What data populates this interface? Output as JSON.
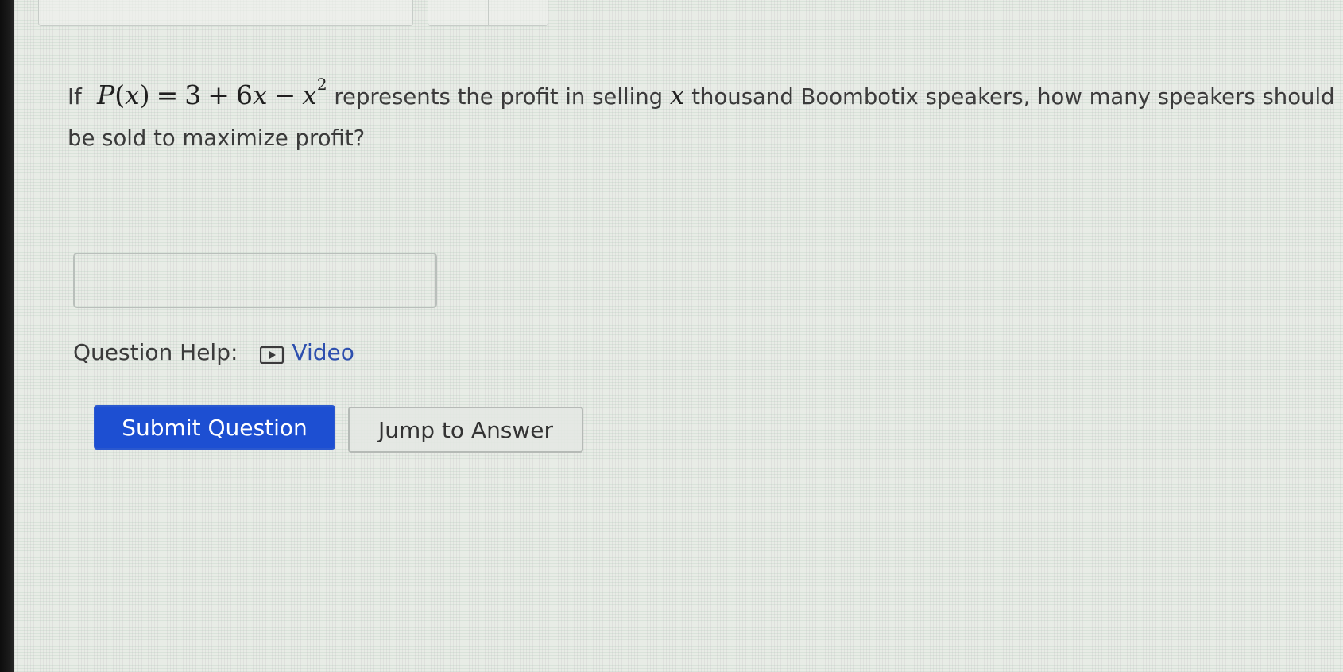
{
  "question": {
    "prefix": "If",
    "formula": {
      "func": "P",
      "var": "x",
      "rhs_const": "3",
      "rhs_term_coef": "6",
      "rhs_term_var": "x",
      "minus_var": "x",
      "exponent": "2"
    },
    "text_after_formula_before_var": "represents the profit in selling",
    "var_inline": "x",
    "text_after_var": "thousand Boombotix speakers, how many speakers should be sold to maximize profit?"
  },
  "answer": {
    "value": "",
    "placeholder": ""
  },
  "help": {
    "label": "Question Help:",
    "video_label": "Video",
    "video_icon": "play-icon"
  },
  "buttons": {
    "submit_label": "Submit Question",
    "jump_label": "Jump to Answer"
  },
  "colors": {
    "submit_bg": "#1d4fd2",
    "link": "#2d4fae"
  }
}
